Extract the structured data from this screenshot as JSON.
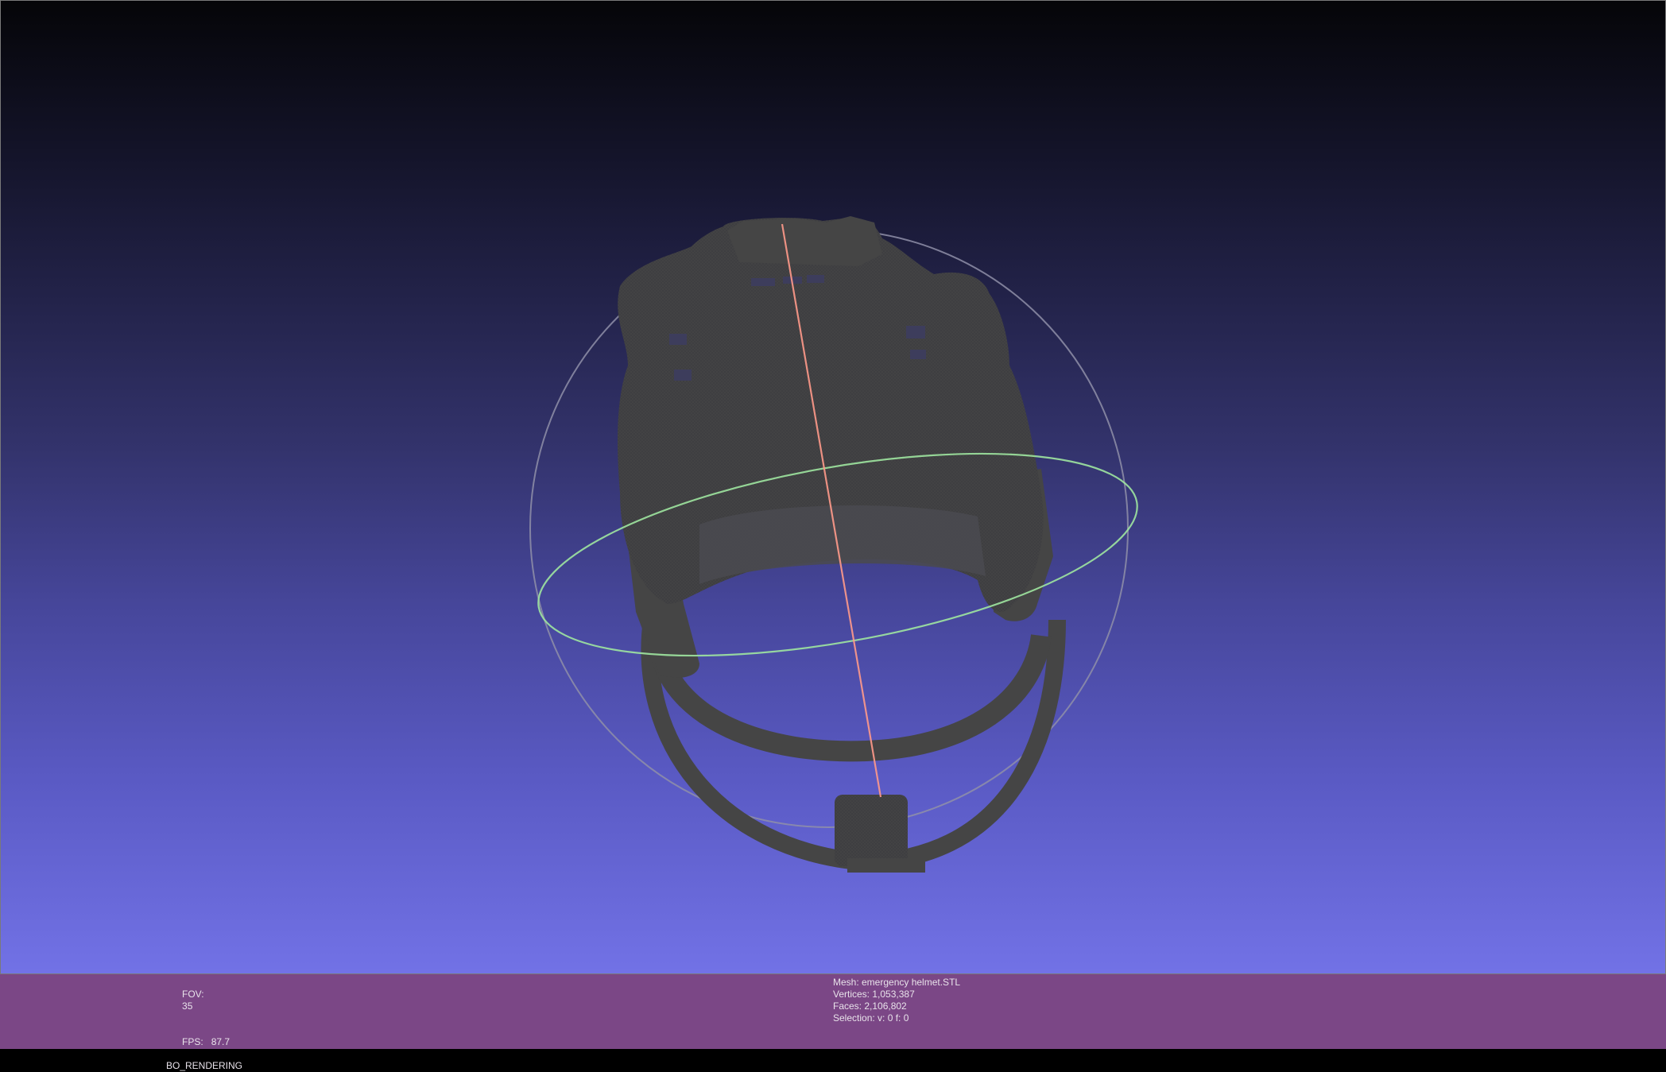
{
  "viewport": {
    "model_name": "emergency helmet STL",
    "colors": {
      "mesh": "#454545",
      "trackball_outline": "#8f8fa8",
      "trackball_ring": "#9fe6a0",
      "trackball_axis": "#ff9a8a",
      "background_top": "#050508",
      "background_bottom": "#7272e6"
    }
  },
  "info_left": {
    "fov_label": "FOV:",
    "fov_value": "35",
    "fps_label": "FPS:",
    "fps_value": "87.7",
    "render_mode": "BO_RENDERING"
  },
  "info_right": {
    "mesh": "Mesh: emergency helmet.STL",
    "vertices": "Vertices: 1,053,387",
    "faces": "Faces: 2,106,802",
    "selection": "Selection: v: 0 f: 0"
  },
  "info_bar": {
    "color": "#7b4786"
  }
}
